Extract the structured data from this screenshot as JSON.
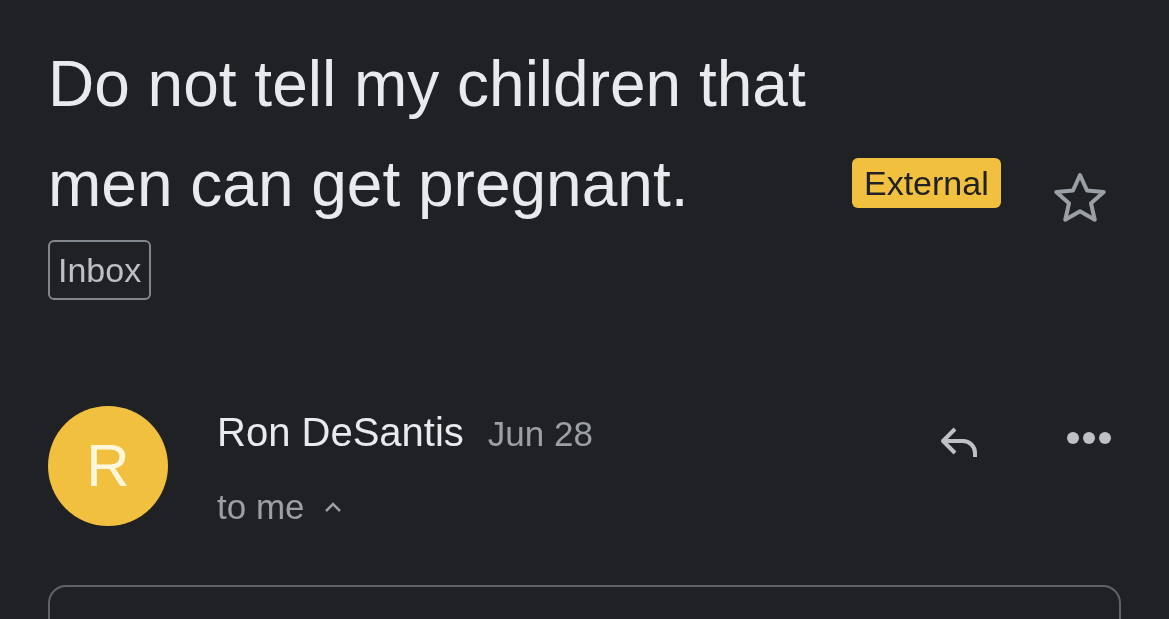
{
  "subject": "Do not tell my children that men can get pregnant.",
  "labels": [
    {
      "text": "External",
      "kind": "external"
    },
    {
      "text": "Inbox",
      "kind": "folder"
    }
  ],
  "starred": false,
  "message": {
    "avatar_letter": "R",
    "sender": "Ron DeSantis",
    "date": "Jun 28",
    "recipient": "to me",
    "details_expanded": true
  }
}
